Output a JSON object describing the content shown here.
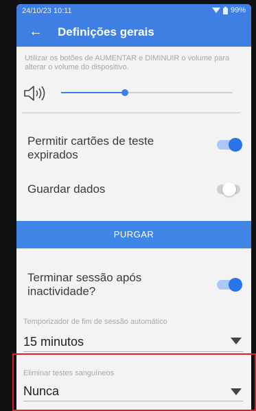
{
  "status_bar": {
    "time": "24/10/23 10:11",
    "battery": "99%"
  },
  "header": {
    "back_icon": "arrow-back-icon",
    "title": "Definições gerais"
  },
  "volume": {
    "help_text": "Utilizar os botões de AUMENTAR e DIMINUIR o volume para alterar o volume do dispositivo.",
    "icon": "speaker-icon",
    "level": 0.37
  },
  "options": {
    "expired_cards": {
      "label": "Permitir cartões de teste expirados",
      "enabled": true
    },
    "save_data": {
      "label": "Guardar dados",
      "enabled": false
    }
  },
  "purge_button": {
    "label": "PURGAR"
  },
  "session": {
    "end_label": "Terminar sessão após inactividade?",
    "end_enabled": true,
    "timer_label": "Temporizador de fim de sessão automático",
    "timer_value": "15 minutos"
  },
  "blood_tests": {
    "label": "Eliminar testes sanguíneos",
    "value": "Nunca"
  },
  "colors": {
    "accent": "#3f7fe4",
    "highlight": "#e11d25"
  }
}
